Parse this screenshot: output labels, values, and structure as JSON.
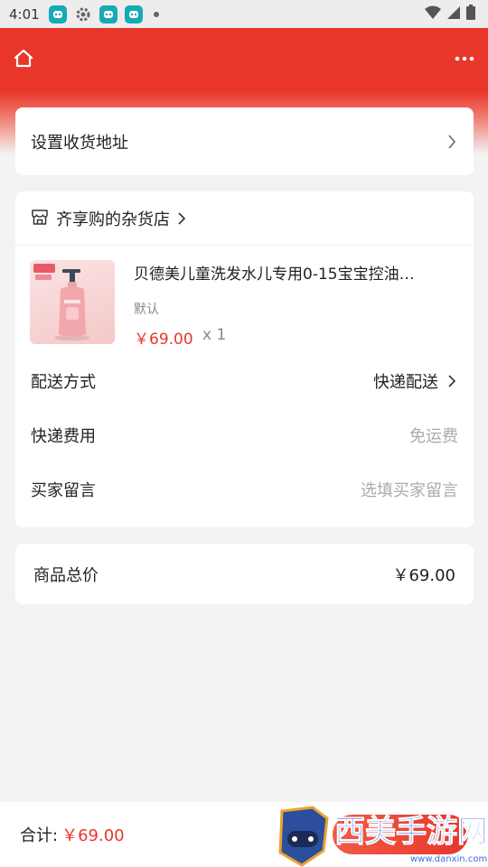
{
  "status_bar": {
    "time": "4:01"
  },
  "address": {
    "label": "设置收货地址"
  },
  "shop": {
    "name": "齐享购的杂货店"
  },
  "product": {
    "title": "贝德美儿童洗发水儿专用0-15宝宝控油…",
    "spec": "默认",
    "price": "￥69.00",
    "quantity": "x 1"
  },
  "delivery": {
    "label": "配送方式",
    "value": "快递配送"
  },
  "shipping_fee": {
    "label": "快递费用",
    "value": "免运费"
  },
  "message": {
    "label": "买家留言",
    "placeholder": "选填买家留言"
  },
  "goods_total": {
    "label": "商品总价",
    "value": "￥69.00"
  },
  "footer": {
    "total_label": "合计:",
    "total_value": "￥69.00"
  },
  "watermark": {
    "text": "西美手游网",
    "url": "www.danxin.com"
  },
  "colors": {
    "brand_red": "#e8362a",
    "background": "#f3f3f3"
  }
}
